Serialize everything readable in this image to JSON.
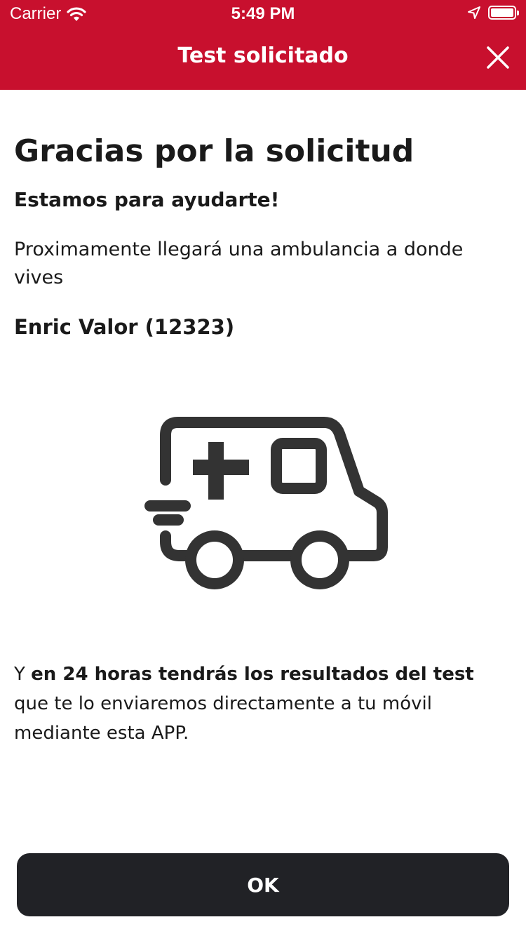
{
  "status_bar": {
    "carrier": "Carrier",
    "time": "5:49 PM",
    "icons": [
      "wifi-icon",
      "location-arrow-icon",
      "battery-icon"
    ]
  },
  "nav": {
    "title": "Test solicitado",
    "close_icon": "close-icon"
  },
  "colors": {
    "header_background": "#c8102e",
    "button_background": "#212226",
    "illustration": "#333333"
  },
  "content": {
    "heading": "Gracias por la solicitud",
    "subheading": "Estamos para ayudarte!",
    "message": "Proximamente llegará una ambulancia a donde vives",
    "patient": "Enric Valor (12323)",
    "illustration_icon": "ambulance-icon",
    "results_prefix": "Y ",
    "results_bold": "en 24 horas tendrás los resultados del test",
    "results_suffix": " que te lo enviaremos directamente a tu móvil mediante esta APP."
  },
  "actions": {
    "ok_label": "OK"
  }
}
